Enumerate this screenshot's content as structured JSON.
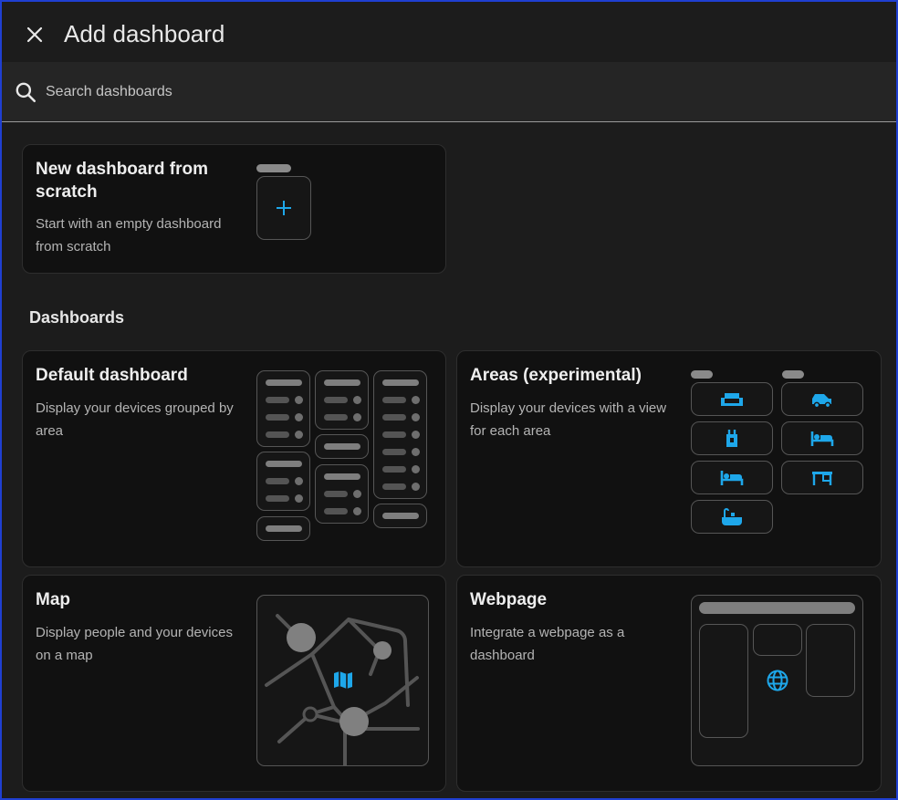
{
  "header": {
    "title": "Add dashboard"
  },
  "search": {
    "placeholder": "Search dashboards"
  },
  "scratch_card": {
    "title": "New dashboard from scratch",
    "description": "Start with an empty dashboard from scratch"
  },
  "section": {
    "title": "Dashboards"
  },
  "cards": [
    {
      "title": "Default dashboard",
      "description": "Display your devices grouped by area"
    },
    {
      "title": "Areas (experimental)",
      "description": "Display your devices with a view for each area"
    },
    {
      "title": "Map",
      "description": "Display people and your devices on a map"
    },
    {
      "title": "Webpage",
      "description": "Integrate a webpage as a dashboard"
    }
  ],
  "icons": {
    "close": "close-icon",
    "search": "search-icon",
    "plus": "plus-icon",
    "sofa": "sofa-icon",
    "car": "car-icon",
    "fridge": "fridge-icon",
    "bed": "bed-icon",
    "desk": "desk-icon",
    "bathtub": "bathtub-icon",
    "map": "map-icon",
    "globe": "globe-icon"
  },
  "colors": {
    "accent": "#1ea7ea",
    "background": "#1c1c1c",
    "card": "#111111",
    "border": "#1f3fd1"
  }
}
